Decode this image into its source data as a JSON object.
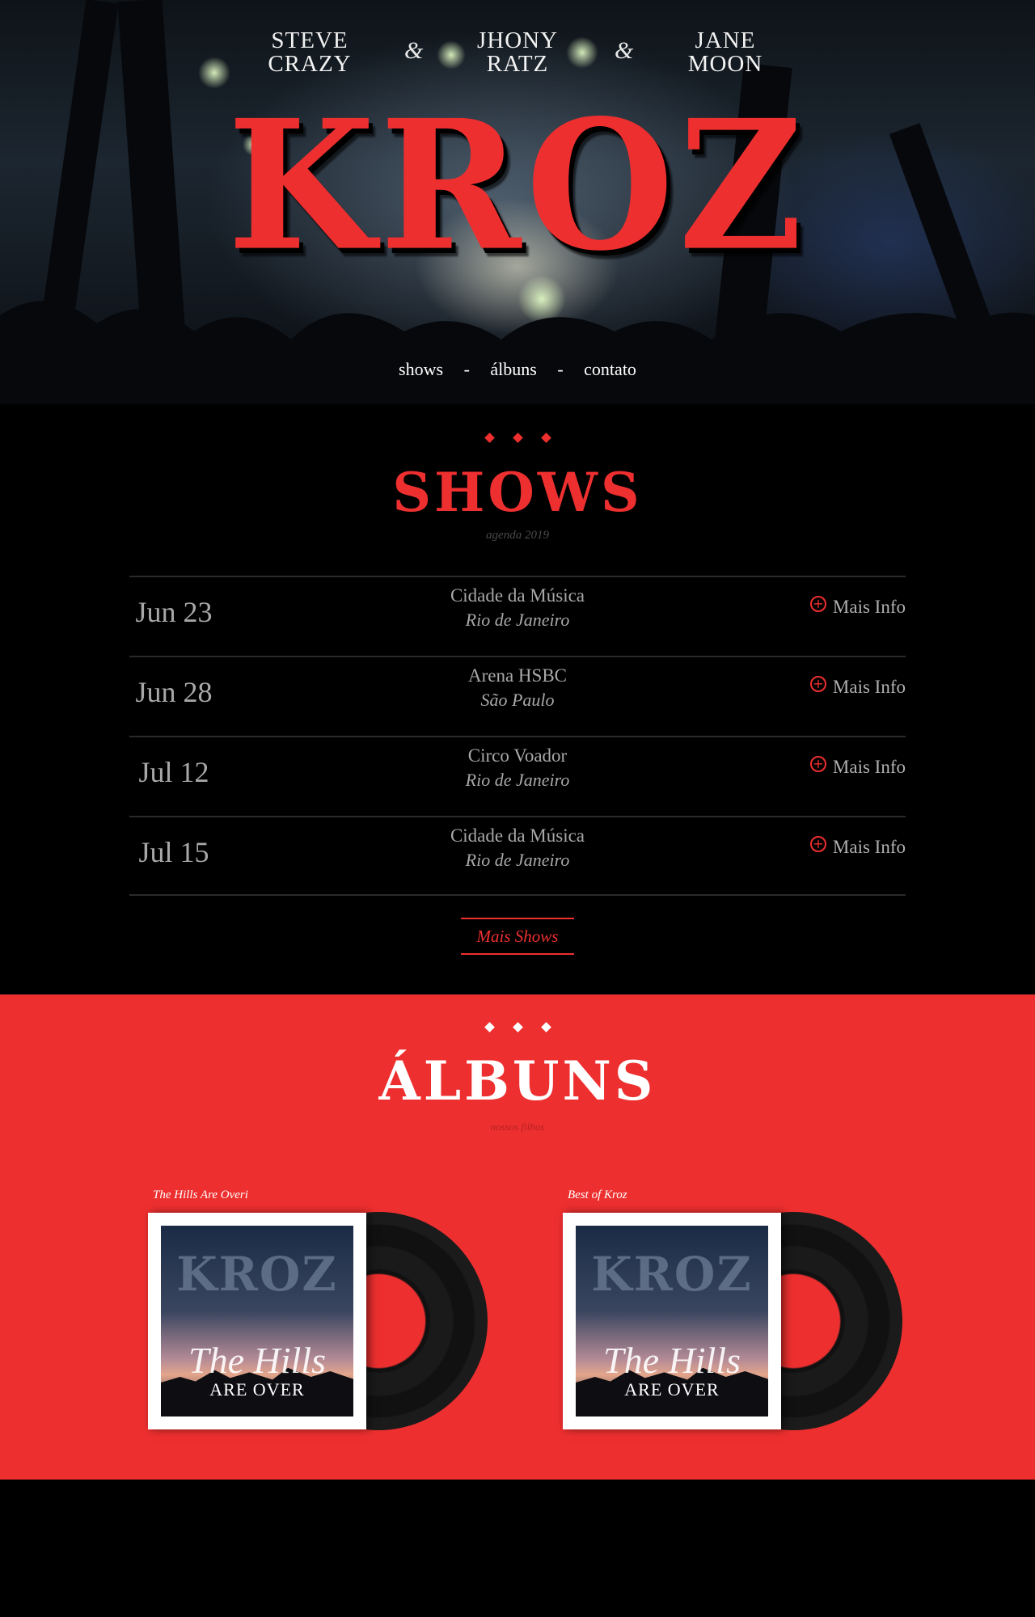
{
  "hero": {
    "members": [
      {
        "first": "STEVE",
        "last": "CRAZY"
      },
      {
        "first": "JHONY",
        "last": "RATZ"
      },
      {
        "first": "JANE",
        "last": "MOON"
      }
    ],
    "ampersand": "&",
    "logo": "KROZ",
    "nav": {
      "shows": "shows",
      "albums": "álbuns",
      "contact": "contato",
      "separator": "-"
    }
  },
  "colors": {
    "accent": "#ee2f2f",
    "background": "#000000",
    "muted_text": "#a8a8a8",
    "divider": "#2a2a2a"
  },
  "shows": {
    "title": "SHOWS",
    "subtitle": "agenda 2019",
    "items": [
      {
        "date": "Jun 23",
        "venue": "Cidade da Música",
        "city": "Rio de Janeiro",
        "link": "Mais Info"
      },
      {
        "date": "Jun 28",
        "venue": "Arena HSBC",
        "city": "São Paulo",
        "link": "Mais Info"
      },
      {
        "date": "Jul 12",
        "venue": "Circo Voador",
        "city": "Rio de Janeiro",
        "link": "Mais Info"
      },
      {
        "date": "Jul 15",
        "venue": "Cidade da Música",
        "city": "Rio de Janeiro",
        "link": "Mais Info"
      }
    ],
    "more_button": "Mais Shows",
    "info_icon": "plus-circle-icon"
  },
  "albums": {
    "title": "ÁLBUNS",
    "subtitle": "nossos filhos",
    "items": [
      {
        "title": "The Hills Are Overi",
        "cover_brand": "KROZ",
        "cover_line1": "The Hills",
        "cover_line2": "ARE OVER"
      },
      {
        "title": "Best of Kroz",
        "cover_brand": "KROZ",
        "cover_line1": "The Hills",
        "cover_line2": "ARE OVER"
      }
    ]
  }
}
